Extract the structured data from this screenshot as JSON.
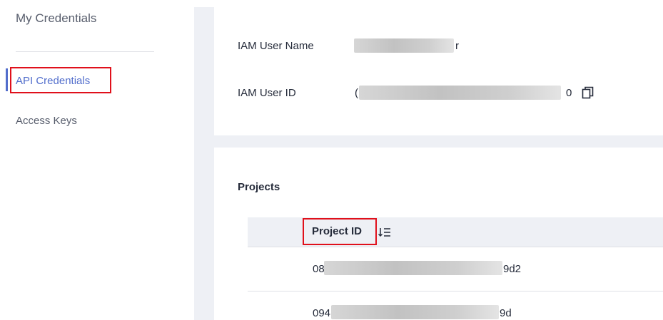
{
  "sidebar": {
    "title": "My Credentials",
    "items": [
      {
        "label": "API Credentials"
      },
      {
        "label": "Access Keys"
      }
    ]
  },
  "credentials": {
    "iam_user_name_label": "IAM User Name",
    "iam_user_name_visible_suffix": "r",
    "iam_user_id_label": "IAM User ID",
    "iam_user_id_visible_prefix": "(",
    "iam_user_id_visible_suffix": "0"
  },
  "projects": {
    "heading": "Projects",
    "columns": [
      {
        "label": "Project ID"
      }
    ],
    "rows": [
      {
        "prefix": "08",
        "suffix": "9d2"
      },
      {
        "prefix": "094",
        "suffix": "9d"
      }
    ]
  },
  "icons": {
    "copy": "copy-icon",
    "sort": "sort-icon"
  },
  "colors": {
    "accent": "#526ecc",
    "highlight_border": "#e0101b",
    "panel_background": "#eef0f5"
  }
}
